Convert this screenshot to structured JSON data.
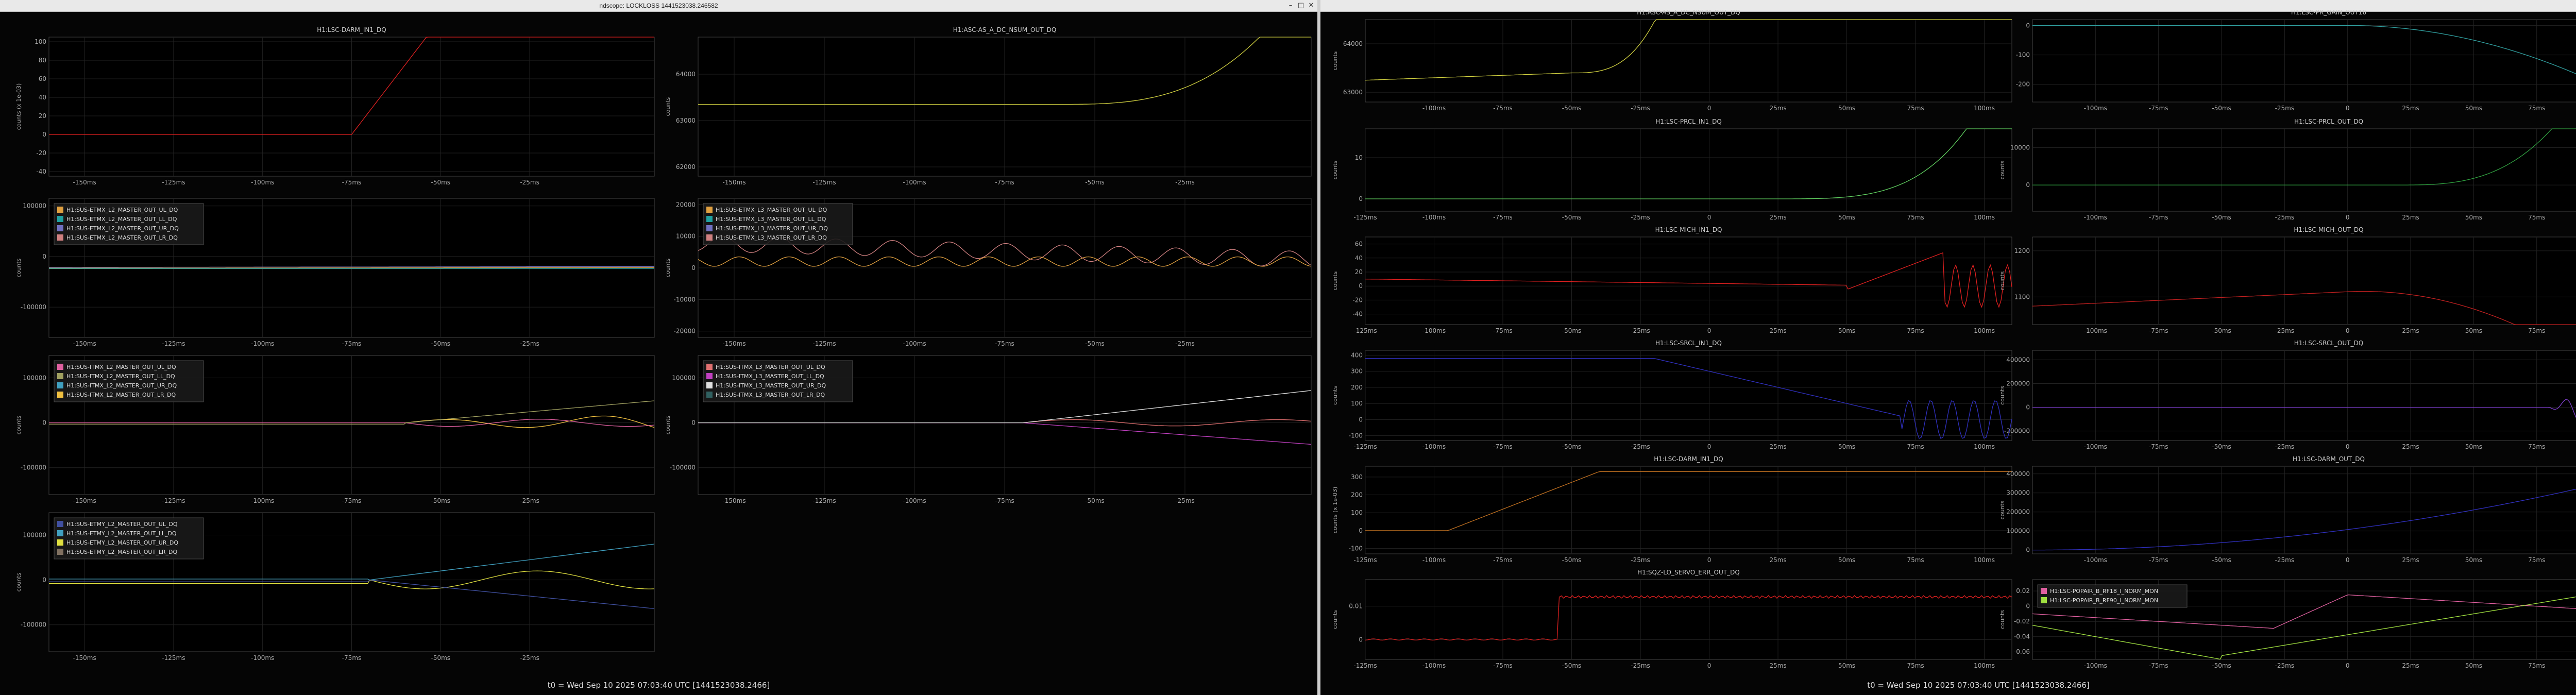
{
  "windows": [
    {
      "title": "ndscope: LOCKLOSS 1441523038.246582",
      "footer": "t0 = Wed Sep 10 2025 07:03:40 UTC [1441523038.2466]"
    },
    {
      "title": "",
      "footer": "t0 = Wed Sep 10 2025 07:03:40 UTC [1441523038.2466]"
    }
  ],
  "window_buttons": {
    "minimize": "–",
    "maximize": "□",
    "close": "✕"
  },
  "colors": {
    "red": "#e82020",
    "yellow": "#f0f060",
    "green": "#60d060",
    "blue": "#3030d0",
    "purple": "#9040d0",
    "teal": "#20a080",
    "orange": "#d08020"
  },
  "plots": [
    {
      "title": "H1:LSC-DARM_IN1_DQ",
      "ylabel": "counts (x 1e-03)",
      "yticks": [
        "100",
        "80",
        "60",
        "40",
        "20",
        "0",
        "-20",
        "-40"
      ],
      "yrange": [
        -45,
        105
      ],
      "xticks": [
        "-150ms",
        "-125ms",
        "-100ms",
        "-75ms",
        "-50ms",
        "-25ms"
      ],
      "xrange": [
        -160,
        10
      ],
      "legend": []
    },
    {
      "title": "H1:ASC-AS_A_DC_NSUM_OUT_DQ",
      "ylabel": "counts",
      "yticks": [
        "64000",
        "63000",
        "62000"
      ],
      "yrange": [
        61800,
        64800
      ],
      "xticks": [
        "-150ms",
        "-125ms",
        "-100ms",
        "-75ms",
        "-50ms",
        "-25ms"
      ],
      "xrange": [
        -160,
        10
      ],
      "legend": []
    },
    {
      "title": "",
      "ylabel": "counts",
      "yticks": [
        "100000",
        "0",
        "-100000"
      ],
      "yrange": [
        -160000,
        115000
      ],
      "xticks": [
        "-150ms",
        "-125ms",
        "-100ms",
        "-75ms",
        "-50ms",
        "-25ms"
      ],
      "xrange": [
        -160,
        10
      ],
      "legend": [
        "H1:SUS-ETMX_L2_MASTER_OUT_UL_DQ",
        "H1:SUS-ETMX_L2_MASTER_OUT_LL_DQ",
        "H1:SUS-ETMX_L2_MASTER_OUT_UR_DQ",
        "H1:SUS-ETMX_L2_MASTER_OUT_LR_DQ"
      ],
      "legend_colors": [
        "#e0a040",
        "#20a0a0",
        "#7070c0",
        "#d08080"
      ]
    },
    {
      "title": "",
      "ylabel": "counts",
      "yticks": [
        "20000",
        "10000",
        "0",
        "-10000",
        "-20000"
      ],
      "yrange": [
        -22000,
        22000
      ],
      "xticks": [
        "-150ms",
        "-125ms",
        "-100ms",
        "-75ms",
        "-50ms",
        "-25ms"
      ],
      "xrange": [
        -160,
        10
      ],
      "legend": [
        "H1:SUS-ETMX_L3_MASTER_OUT_UL_DQ",
        "H1:SUS-ETMX_L3_MASTER_OUT_LL_DQ",
        "H1:SUS-ETMX_L3_MASTER_OUT_UR_DQ",
        "H1:SUS-ETMX_L3_MASTER_OUT_LR_DQ"
      ],
      "legend_colors": [
        "#e0a040",
        "#20a0a0",
        "#7070c0",
        "#d08080"
      ]
    },
    {
      "title": "",
      "ylabel": "counts",
      "yticks": [
        "100000",
        "0",
        "-100000"
      ],
      "yrange": [
        -160000,
        150000
      ],
      "xticks": [
        "-150ms",
        "-125ms",
        "-100ms",
        "-75ms",
        "-50ms",
        "-25ms"
      ],
      "xrange": [
        -160,
        10
      ],
      "legend": [
        "H1:SUS-ITMX_L2_MASTER_OUT_UL_DQ",
        "H1:SUS-ITMX_L2_MASTER_OUT_LL_DQ",
        "H1:SUS-ITMX_L2_MASTER_OUT_UR_DQ",
        "H1:SUS-ITMX_L2_MASTER_OUT_LR_DQ"
      ],
      "legend_colors": [
        "#e060a0",
        "#a0a060",
        "#40a0c0",
        "#f0c040"
      ]
    },
    {
      "title": "",
      "ylabel": "counts",
      "yticks": [
        "100000",
        "0",
        "-100000"
      ],
      "yrange": [
        -160000,
        150000
      ],
      "xticks": [
        "-150ms",
        "-125ms",
        "-100ms",
        "-75ms",
        "-50ms",
        "-25ms"
      ],
      "xrange": [
        -160,
        10
      ],
      "legend": [
        "H1:SUS-ITMX_L3_MASTER_OUT_UL_DQ",
        "H1:SUS-ITMX_L3_MASTER_OUT_LL_DQ",
        "H1:SUS-ITMX_L3_MASTER_OUT_UR_DQ",
        "H1:SUS-ITMX_L3_MASTER_OUT_LR_DQ"
      ],
      "legend_colors": [
        "#e07070",
        "#c040c0",
        "#e0e0e0",
        "#306060"
      ]
    },
    {
      "title": "",
      "ylabel": "counts",
      "yticks": [
        "100000",
        "0",
        "-100000"
      ],
      "yrange": [
        -160000,
        150000
      ],
      "xticks": [
        "-150ms",
        "-125ms",
        "-100ms",
        "-75ms",
        "-50ms",
        "-25ms"
      ],
      "xrange": [
        -160,
        10
      ],
      "legend": [
        "H1:SUS-ETMY_L2_MASTER_OUT_UL_DQ",
        "H1:SUS-ETMY_L2_MASTER_OUT_LL_DQ",
        "H1:SUS-ETMY_L2_MASTER_OUT_UR_DQ",
        "H1:SUS-ETMY_L2_MASTER_OUT_LR_DQ"
      ],
      "legend_colors": [
        "#4050a0",
        "#40a0c0",
        "#e0e040",
        "#807060"
      ]
    },
    {
      "title": "H1:ASC-AS_A_DC_NSUM_OUT_DQ",
      "ylabel": "counts",
      "yticks": [
        "64000",
        "63000"
      ],
      "yrange": [
        62800,
        64500
      ],
      "xticks": [
        "-100ms",
        "-75ms",
        "-50ms",
        "-25ms",
        "0",
        "25ms",
        "50ms",
        "75ms",
        "100ms"
      ],
      "xrange": [
        -125,
        110
      ],
      "legend": []
    },
    {
      "title": "H1:LSC-PR_GAIN_OUT16",
      "ylabel": "",
      "yticks": [
        "0",
        "-100",
        "-200"
      ],
      "yrange": [
        -260,
        20
      ],
      "xticks": [
        "-100ms",
        "-75ms",
        "-50ms",
        "-25ms",
        "0",
        "25ms",
        "50ms",
        "75ms",
        "100ms"
      ],
      "xrange": [
        -125,
        110
      ],
      "legend": []
    },
    {
      "title": "H1:LSC-PRCL_IN1_DQ",
      "ylabel": "counts",
      "yticks": [
        "10",
        "0"
      ],
      "yrange": [
        -3,
        17
      ],
      "xticks": [
        "-125ms",
        "-100ms",
        "-75ms",
        "-50ms",
        "-25ms",
        "0",
        "25ms",
        "50ms",
        "75ms",
        "100ms"
      ],
      "xrange": [
        -125,
        110
      ],
      "legend": []
    },
    {
      "title": "H1:LSC-PRCL_OUT_DQ",
      "ylabel": "counts",
      "yticks": [
        "10000",
        "0"
      ],
      "yrange": [
        -7000,
        15000
      ],
      "xticks": [
        "-100ms",
        "-75ms",
        "-50ms",
        "-25ms",
        "0",
        "25ms",
        "50ms",
        "75ms",
        "100ms"
      ],
      "xrange": [
        -125,
        110
      ],
      "legend": []
    },
    {
      "title": "H1:LSC-MICH_IN1_DQ",
      "ylabel": "counts",
      "yticks": [
        "60",
        "40",
        "20",
        "0",
        "-20",
        "-40"
      ],
      "yrange": [
        -55,
        70
      ],
      "xticks": [
        "-125ms",
        "-100ms",
        "-75ms",
        "-50ms",
        "-25ms",
        "0",
        "25ms",
        "50ms",
        "75ms",
        "100ms"
      ],
      "xrange": [
        -125,
        110
      ],
      "legend": []
    },
    {
      "title": "H1:LSC-MICH_OUT_DQ",
      "ylabel": "counts",
      "yticks": [
        "1200",
        "1100"
      ],
      "yrange": [
        1040,
        1230
      ],
      "xticks": [
        "-100ms",
        "-75ms",
        "-50ms",
        "-25ms",
        "0",
        "25ms",
        "50ms",
        "75ms",
        "100ms"
      ],
      "xrange": [
        -125,
        110
      ],
      "legend": []
    },
    {
      "title": "H1:LSC-SRCL_IN1_DQ",
      "ylabel": "counts",
      "yticks": [
        "400",
        "300",
        "200",
        "100",
        "0",
        "-100"
      ],
      "yrange": [
        -130,
        430
      ],
      "xticks": [
        "-125ms",
        "-100ms",
        "-75ms",
        "-50ms",
        "-25ms",
        "0",
        "25ms",
        "50ms",
        "75ms",
        "100ms"
      ],
      "xrange": [
        -125,
        110
      ],
      "legend": []
    },
    {
      "title": "H1:LSC-SRCL_OUT_DQ",
      "ylabel": "counts",
      "yticks": [
        "400000",
        "200000",
        "0",
        "-200000"
      ],
      "yrange": [
        -280000,
        480000
      ],
      "xticks": [
        "-100ms",
        "-75ms",
        "-50ms",
        "-25ms",
        "0",
        "25ms",
        "50ms",
        "75ms",
        "100ms"
      ],
      "xrange": [
        -125,
        110
      ],
      "legend": []
    },
    {
      "title": "H1:LSC-DARM_IN1_DQ",
      "ylabel": "counts (x 1e-03)",
      "yticks": [
        "300",
        "200",
        "100",
        "0",
        "-100"
      ],
      "yrange": [
        -130,
        360
      ],
      "xticks": [
        "-125ms",
        "-100ms",
        "-75ms",
        "-50ms",
        "-25ms",
        "0",
        "25ms",
        "50ms",
        "75ms",
        "100ms"
      ],
      "xrange": [
        -125,
        110
      ],
      "legend": []
    },
    {
      "title": "H1:LSC-DARM_OUT_DQ",
      "ylabel": "counts",
      "yticks": [
        "400000",
        "300000",
        "200000",
        "100000",
        "0"
      ],
      "yrange": [
        -20000,
        440000
      ],
      "xticks": [
        "-100ms",
        "-75ms",
        "-50ms",
        "-25ms",
        "0",
        "25ms",
        "50ms",
        "75ms",
        "100ms"
      ],
      "xrange": [
        -125,
        110
      ],
      "legend": []
    },
    {
      "title": "H1:SQZ-LO_SERVO_ERR_OUT_DQ",
      "ylabel": "counts",
      "yticks": [
        "0.01",
        "0"
      ],
      "yrange": [
        -0.006,
        0.018
      ],
      "xticks": [
        "-125ms",
        "-100ms",
        "-75ms",
        "-50ms",
        "-25ms",
        "0",
        "25ms",
        "50ms",
        "75ms",
        "100ms"
      ],
      "xrange": [
        -125,
        110
      ],
      "legend": []
    },
    {
      "title": "",
      "ylabel": "counts",
      "yticks": [
        "0.02",
        "0",
        "-0.02",
        "-0.04",
        "-0.06"
      ],
      "yrange": [
        -0.07,
        0.035
      ],
      "xticks": [
        "-100ms",
        "-75ms",
        "-50ms",
        "-25ms",
        "0",
        "25ms",
        "50ms",
        "75ms",
        "100ms"
      ],
      "xrange": [
        -125,
        110
      ],
      "legend": [
        "H1:LSC-POPAIR_B_RF18_I_NORM_MON",
        "H1:LSC-POPAIR_B_RF90_I_NORM_MON"
      ],
      "legend_colors": [
        "#e060a0",
        "#a0e040"
      ]
    }
  ]
}
